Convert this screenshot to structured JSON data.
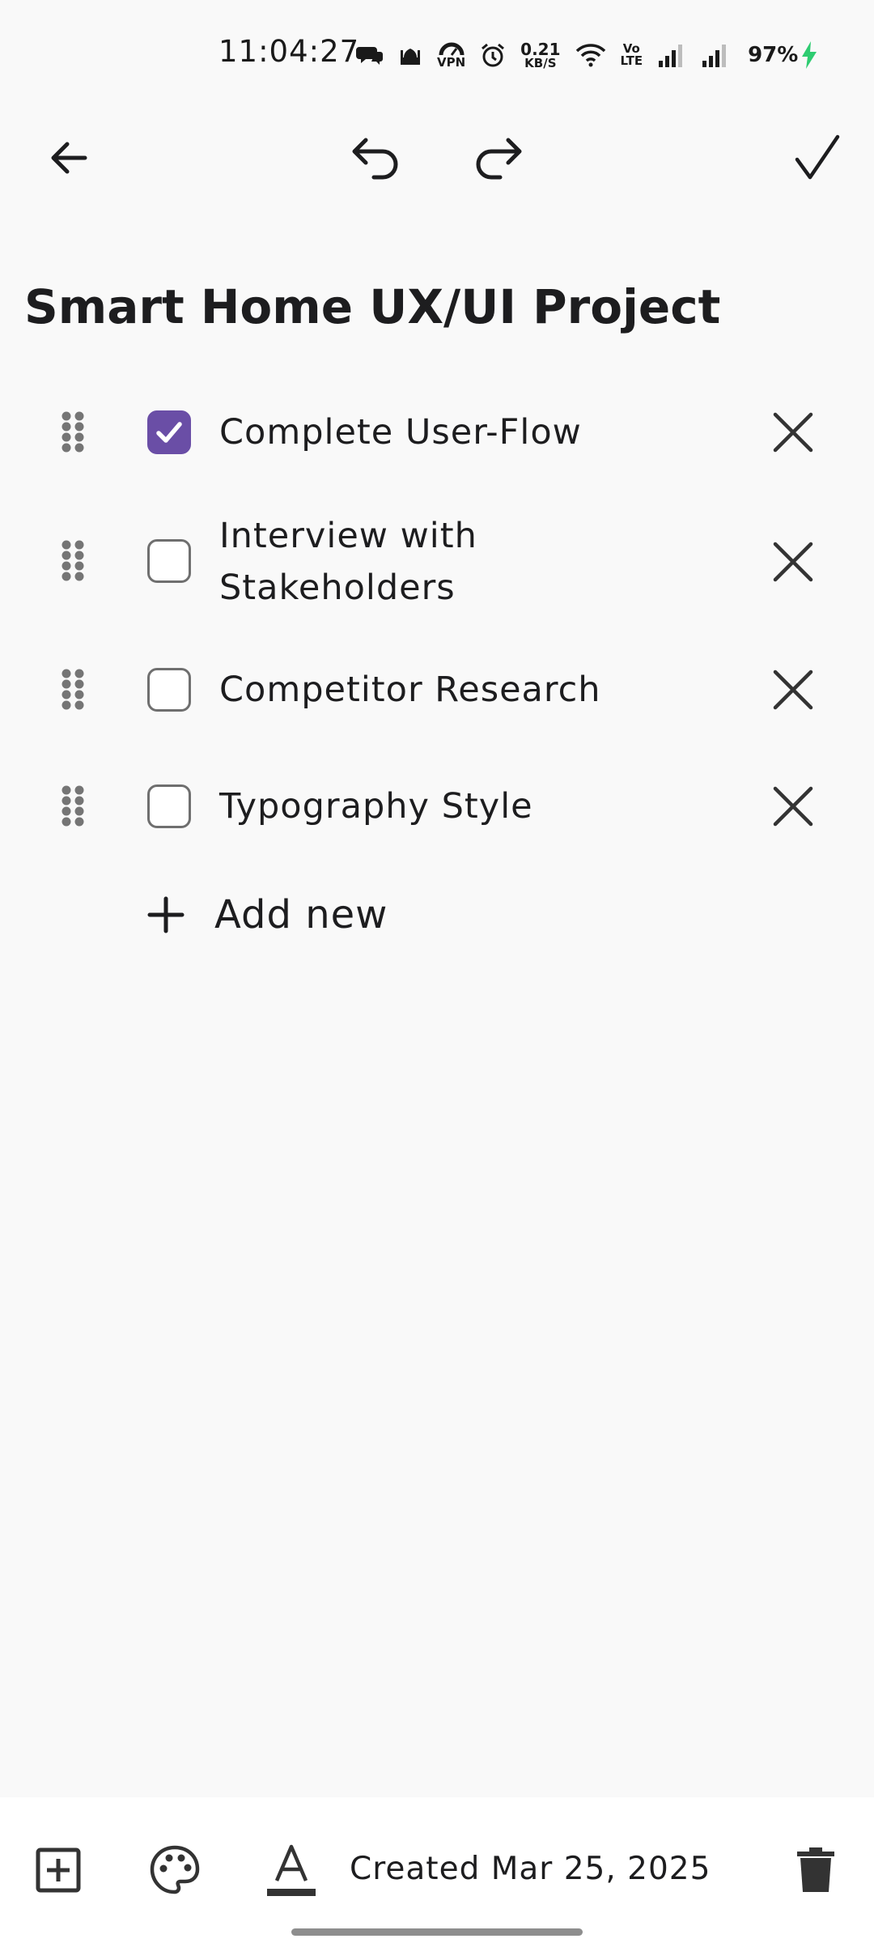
{
  "status_bar": {
    "time": "11:04:27",
    "vpn_label": "VPN",
    "net_speed_value": "0.21",
    "net_speed_unit": "KB/S",
    "volte_top": "Vo",
    "volte_bottom": "LTE",
    "battery": "97%",
    "icons": [
      "chat-bubble-icon",
      "mosque-icon",
      "vpn-icon",
      "alarm-icon",
      "wifi-icon",
      "volte-icon",
      "signal-icon",
      "signal-icon",
      "charging-icon"
    ]
  },
  "toolbar": {
    "back_icon": "arrow-left-icon",
    "undo_icon": "undo-icon",
    "redo_icon": "redo-icon",
    "done_icon": "check-icon"
  },
  "note": {
    "title": "Smart Home UX/UI Project",
    "items": [
      {
        "label": "Complete User-Flow",
        "checked": true
      },
      {
        "label": "Interview with Stakeholders",
        "checked": false
      },
      {
        "label": "Competitor Research",
        "checked": false
      },
      {
        "label": "Typography Style",
        "checked": false
      }
    ],
    "add_new_label": "Add new"
  },
  "bottom_bar": {
    "created_label": "Created Mar 25, 2025",
    "icons": [
      "add-box-icon",
      "palette-icon",
      "text-format-icon",
      "trash-icon"
    ]
  },
  "colors": {
    "accent": "#6a4ea6",
    "background": "#f9f9f9",
    "text": "#1d1d1f",
    "charging": "#2ecc71"
  }
}
